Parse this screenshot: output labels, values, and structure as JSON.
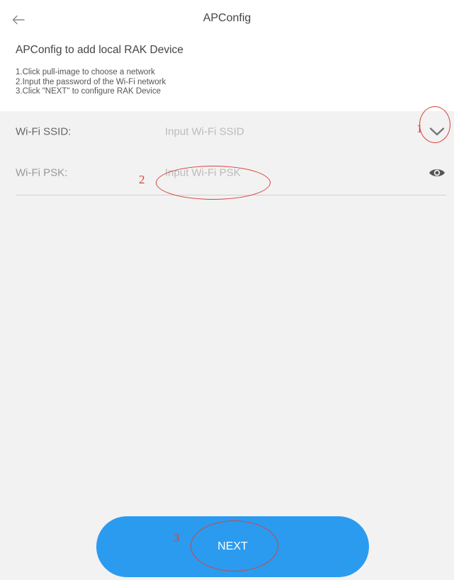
{
  "header": {
    "title": "APConfig",
    "back_icon": "arrow-left-icon"
  },
  "intro": {
    "title": "APConfig to add local RAK Device",
    "steps": [
      "1.Click pull-image to choose a network",
      "2.Input the password of the Wi-Fi network",
      "3.Click \"NEXT\" to configure RAK Device"
    ]
  },
  "form": {
    "ssid": {
      "label": "Wi-Fi SSID:",
      "placeholder": "Input Wi-Fi SSID",
      "value": "",
      "action_icon": "chevron-down-icon"
    },
    "psk": {
      "label": "Wi-Fi PSK:",
      "placeholder": "Input Wi-Fi PSK",
      "value": "",
      "action_icon": "eye-icon"
    }
  },
  "next_button": {
    "label": "NEXT",
    "color": "#2b9bf0"
  },
  "annotations": {
    "color": "#d9413a",
    "markers": [
      "1",
      "2",
      "3"
    ]
  }
}
